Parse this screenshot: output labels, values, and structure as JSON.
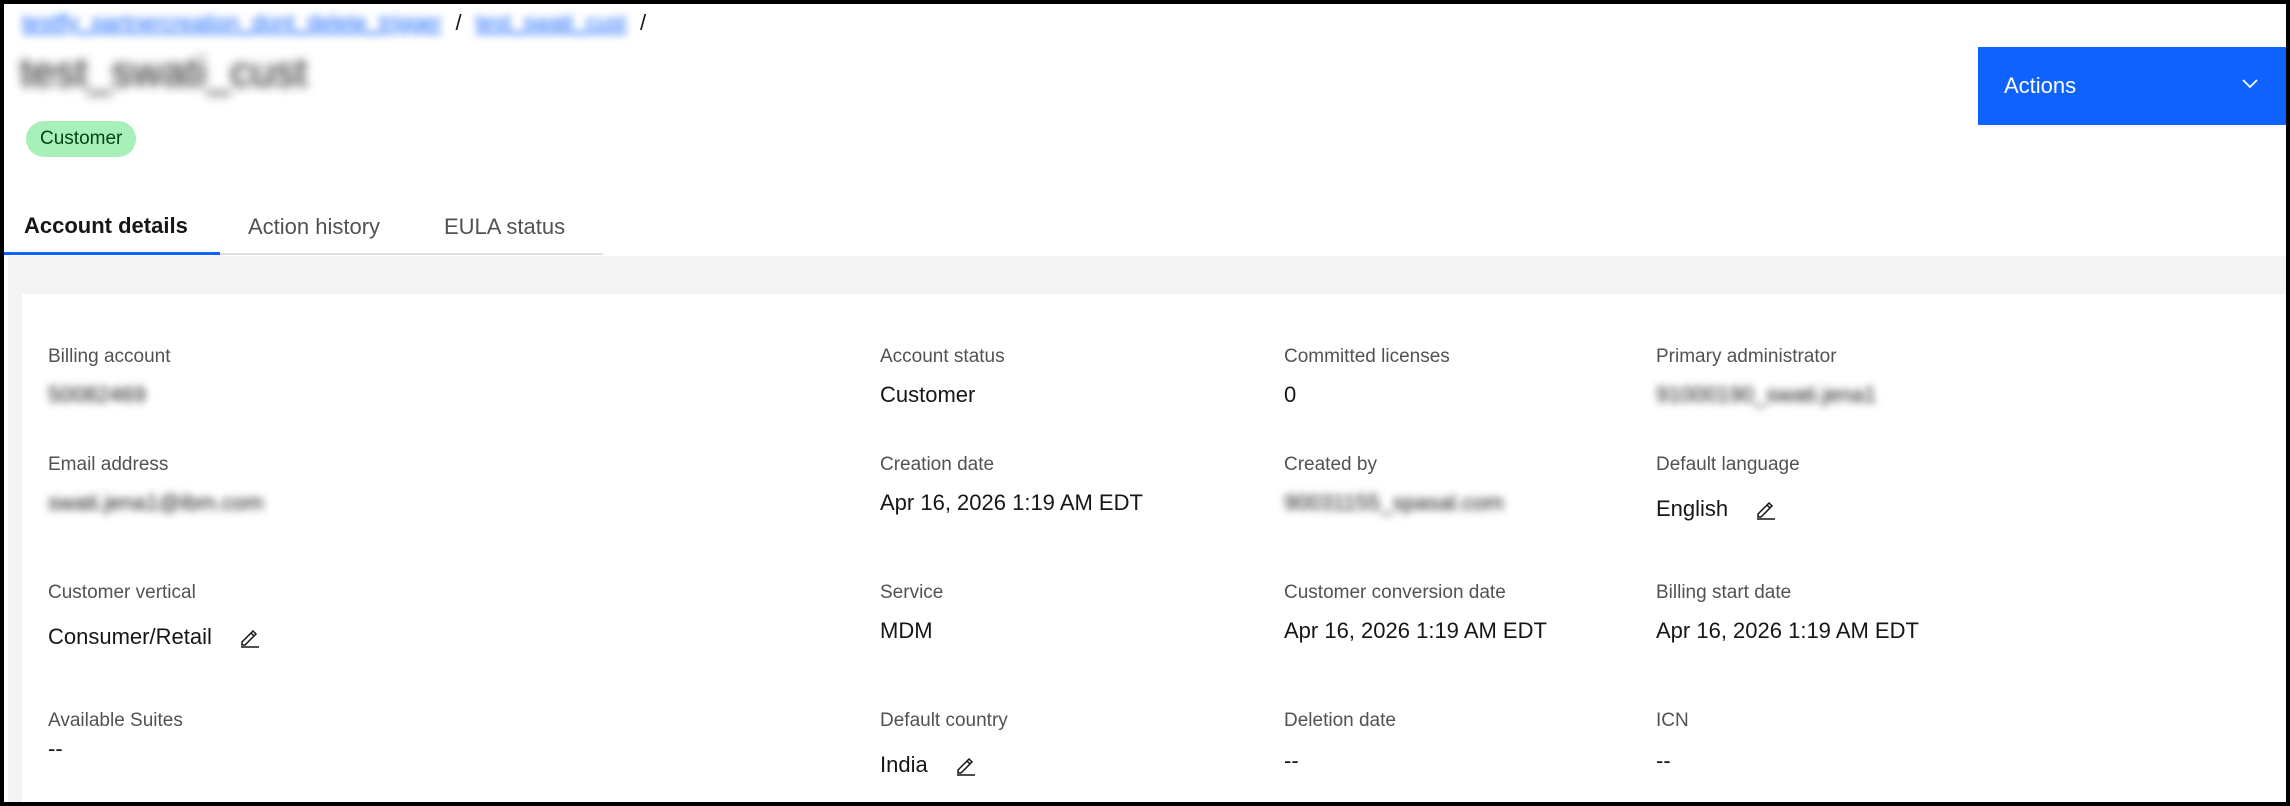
{
  "breadcrumb": {
    "items": [
      "testfly_partnercreation_dont_delete_trigger",
      "test_swati_cust"
    ],
    "separator": "/"
  },
  "page": {
    "title": "test_swati_cust",
    "tag": "Customer",
    "actions_label": "Actions"
  },
  "tabs": [
    {
      "label": "Account details",
      "active": true
    },
    {
      "label": "Action history",
      "active": false
    },
    {
      "label": "EULA status",
      "active": false
    }
  ],
  "details": {
    "billing_account": {
      "label": "Billing account",
      "value": "50082469"
    },
    "account_status": {
      "label": "Account status",
      "value": "Customer"
    },
    "committed_licenses": {
      "label": "Committed licenses",
      "value": "0"
    },
    "primary_admin": {
      "label": "Primary administrator",
      "value": "91000190_swati.jena1"
    },
    "email": {
      "label": "Email address",
      "value": "swati.jena1@ibm.com"
    },
    "creation_date": {
      "label": "Creation date",
      "value": "Apr 16, 2026 1:19 AM EDT"
    },
    "created_by": {
      "label": "Created by",
      "value": "90031155_spasal.com"
    },
    "default_language": {
      "label": "Default language",
      "value": "English"
    },
    "customer_vertical": {
      "label": "Customer vertical",
      "value": "Consumer/Retail"
    },
    "service": {
      "label": "Service",
      "value": "MDM"
    },
    "conversion_date": {
      "label": "Customer conversion date",
      "value": "Apr 16, 2026 1:19 AM EDT"
    },
    "billing_start": {
      "label": "Billing start date",
      "value": "Apr 16, 2026 1:19 AM EDT"
    },
    "available_suites": {
      "label": "Available Suites",
      "value": "--"
    },
    "default_country": {
      "label": "Default country",
      "value": "India"
    },
    "deletion_date": {
      "label": "Deletion date",
      "value": "--"
    },
    "icn": {
      "label": "ICN",
      "value": "--"
    }
  },
  "icons": {
    "edit": "edit-icon",
    "dropdown": "chevron-down-icon"
  },
  "colors": {
    "accent": "#0f62fe",
    "tag_bg": "#a7f0ba",
    "tag_text": "#044317",
    "panel_bg": "#f4f4f4"
  }
}
